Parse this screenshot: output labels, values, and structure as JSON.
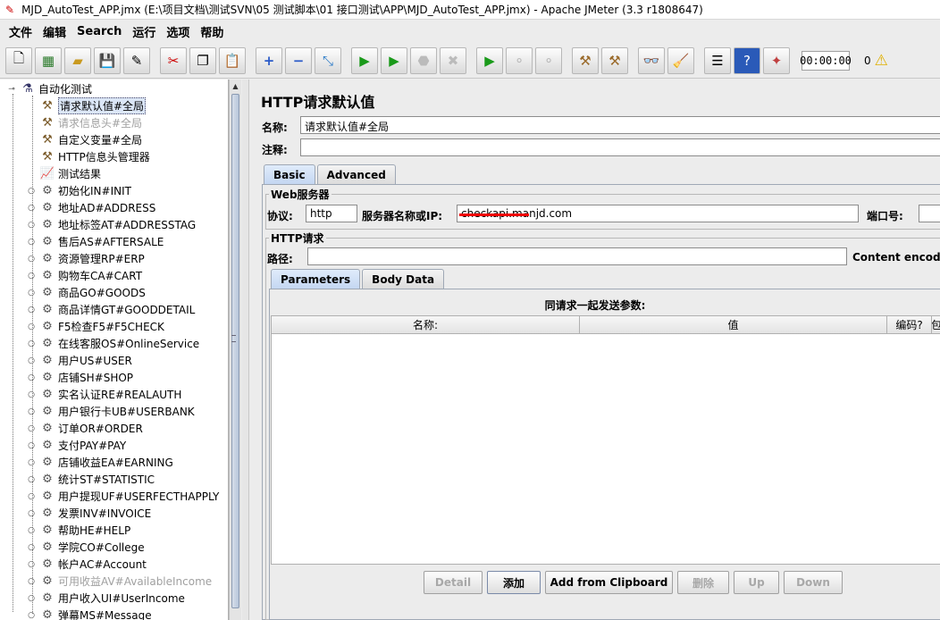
{
  "window": {
    "title": "MJD_AutoTest_APP.jmx (E:\\项目文档\\测试SVN\\05 测试脚本\\01 接口测试\\APP\\MJD_AutoTest_APP.jmx) - Apache JMeter (3.3 r1808647)"
  },
  "menu": [
    "文件",
    "编辑",
    "Search",
    "运行",
    "选项",
    "帮助"
  ],
  "toolbar": {
    "timer": "00:00:00",
    "error_count": "0",
    "icons": [
      "new-icon",
      "templates-icon",
      "open-icon",
      "save-icon",
      "save-as-icon",
      "cut-icon",
      "copy-icon",
      "paste-icon",
      "expand-icon",
      "collapse-icon",
      "toggle-icon",
      "start-icon",
      "start-no-pause-icon",
      "stop-icon",
      "shutdown-icon",
      "remote-start-icon",
      "remote-stop-icon",
      "remote-shutdown-icon",
      "clear-icon",
      "clear-all-icon",
      "search-icon",
      "reset-search-icon",
      "function-helper-icon",
      "help-icon",
      "log-viewer-icon",
      "warning-icon"
    ]
  },
  "tree": {
    "root": "自动化测试",
    "items": [
      {
        "label": "请求默认值#全局",
        "icon": "tool-icon",
        "disabled": false,
        "selected": true,
        "expandable": false
      },
      {
        "label": "请求信息头#全局",
        "icon": "tool-icon",
        "disabled": true,
        "selected": false,
        "expandable": false
      },
      {
        "label": "自定义变量#全局",
        "icon": "tool-icon",
        "disabled": false,
        "selected": false,
        "expandable": false
      },
      {
        "label": "HTTP信息头管理器",
        "icon": "tool-icon",
        "disabled": false,
        "selected": false,
        "expandable": false
      },
      {
        "label": "测试结果",
        "icon": "chart-icon",
        "disabled": false,
        "selected": false,
        "expandable": false
      },
      {
        "label": "初始化IN#INIT",
        "icon": "gear-icon",
        "disabled": false,
        "selected": false,
        "expandable": true
      },
      {
        "label": "地址AD#ADDRESS",
        "icon": "gear-icon",
        "disabled": false,
        "selected": false,
        "expandable": true
      },
      {
        "label": "地址标签AT#ADDRESSTAG",
        "icon": "gear-icon",
        "disabled": false,
        "selected": false,
        "expandable": true
      },
      {
        "label": "售后AS#AFTERSALE",
        "icon": "gear-icon",
        "disabled": false,
        "selected": false,
        "expandable": true
      },
      {
        "label": "资源管理RP#ERP",
        "icon": "gear-icon",
        "disabled": false,
        "selected": false,
        "expandable": true
      },
      {
        "label": "购物车CA#CART",
        "icon": "gear-icon",
        "disabled": false,
        "selected": false,
        "expandable": true
      },
      {
        "label": "商品GO#GOODS",
        "icon": "gear-icon",
        "disabled": false,
        "selected": false,
        "expandable": true
      },
      {
        "label": "商品详情GT#GOODDETAIL",
        "icon": "gear-icon",
        "disabled": false,
        "selected": false,
        "expandable": true
      },
      {
        "label": "F5检查F5#F5CHECK",
        "icon": "gear-icon",
        "disabled": false,
        "selected": false,
        "expandable": true
      },
      {
        "label": "在线客服OS#OnlineService",
        "icon": "gear-icon",
        "disabled": false,
        "selected": false,
        "expandable": true
      },
      {
        "label": "用户US#USER",
        "icon": "gear-icon",
        "disabled": false,
        "selected": false,
        "expandable": true
      },
      {
        "label": "店铺SH#SHOP",
        "icon": "gear-icon",
        "disabled": false,
        "selected": false,
        "expandable": true
      },
      {
        "label": "实名认证RE#REALAUTH",
        "icon": "gear-icon",
        "disabled": false,
        "selected": false,
        "expandable": true
      },
      {
        "label": "用户银行卡UB#USERBANK",
        "icon": "gear-icon",
        "disabled": false,
        "selected": false,
        "expandable": true
      },
      {
        "label": "订单OR#ORDER",
        "icon": "gear-icon",
        "disabled": false,
        "selected": false,
        "expandable": true
      },
      {
        "label": "支付PAY#PAY",
        "icon": "gear-icon",
        "disabled": false,
        "selected": false,
        "expandable": true
      },
      {
        "label": "店铺收益EA#EARNING",
        "icon": "gear-icon",
        "disabled": false,
        "selected": false,
        "expandable": true
      },
      {
        "label": "统计ST#STATISTIC",
        "icon": "gear-icon",
        "disabled": false,
        "selected": false,
        "expandable": true
      },
      {
        "label": "用户提现UF#USERFECTHAPPLY",
        "icon": "gear-icon",
        "disabled": false,
        "selected": false,
        "expandable": true
      },
      {
        "label": "发票INV#INVOICE",
        "icon": "gear-icon",
        "disabled": false,
        "selected": false,
        "expandable": true
      },
      {
        "label": "帮助HE#HELP",
        "icon": "gear-icon",
        "disabled": false,
        "selected": false,
        "expandable": true
      },
      {
        "label": "学院CO#College",
        "icon": "gear-icon",
        "disabled": false,
        "selected": false,
        "expandable": true
      },
      {
        "label": "帐户AC#Account",
        "icon": "gear-icon",
        "disabled": false,
        "selected": false,
        "expandable": true
      },
      {
        "label": "可用收益AV#AvailableIncome",
        "icon": "gear-icon",
        "disabled": true,
        "selected": false,
        "expandable": true
      },
      {
        "label": "用户收入UI#UserIncome",
        "icon": "gear-icon",
        "disabled": false,
        "selected": false,
        "expandable": true
      },
      {
        "label": "弹幕MS#Message",
        "icon": "gear-icon",
        "disabled": false,
        "selected": false,
        "expandable": true
      }
    ]
  },
  "panel": {
    "title": "HTTP请求默认值",
    "name_label": "名称:",
    "name_value": "请求默认值#全局",
    "comment_label": "注释:",
    "comment_value": "",
    "tabs": [
      "Basic",
      "Advanced"
    ],
    "web_server": {
      "group_title": "Web服务器",
      "protocol_label": "协议:",
      "protocol_value": "http",
      "server_label": "服务器名称或IP:",
      "server_value": "checkapi.manjd.com",
      "port_label": "端口号:",
      "port_value": ""
    },
    "http_request": {
      "group_title": "HTTP请求",
      "path_label": "路径:",
      "path_value": "",
      "encoding_label": "Content encoding"
    },
    "sub_tabs": [
      "Parameters",
      "Body Data"
    ],
    "params": {
      "caption": "同请求一起发送参数:",
      "columns": [
        "名称:",
        "值",
        "编码?",
        "包"
      ]
    },
    "buttons": {
      "detail": "Detail",
      "add": "添加",
      "add_clipboard": "Add from Clipboard",
      "delete": "删除",
      "up": "Up",
      "down": "Down"
    }
  }
}
